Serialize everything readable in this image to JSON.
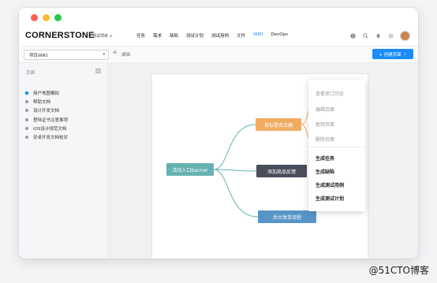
{
  "app": {
    "brand": "CORNERSTONE",
    "project_switch": "测试项目 ∨"
  },
  "nav": {
    "items": [
      {
        "label": "任务",
        "active": false
      },
      {
        "label": "需求",
        "active": false
      },
      {
        "label": "缺陷",
        "active": false
      },
      {
        "label": "测试计划",
        "active": false
      },
      {
        "label": "测试用例",
        "active": false
      },
      {
        "label": "文件",
        "active": false
      },
      {
        "label": "WIKI",
        "active": true
      },
      {
        "label": "DevOps",
        "active": false
      }
    ]
  },
  "toolbar": {
    "wiki_select": "项目WIKI",
    "add": "+",
    "edit_label": "编辑",
    "create_button": "+ 创建页面",
    "create_caret": "∨"
  },
  "sidebar": {
    "header": "页面",
    "items": [
      {
        "label": "用户地图模拟",
        "active": true
      },
      {
        "label": "帮助文档",
        "active": false
      },
      {
        "label": "设计开发文档",
        "active": false
      },
      {
        "label": "登陆证书注意事项",
        "active": false
      },
      {
        "label": "iOS设计规范文档",
        "active": false
      },
      {
        "label": "安卓开发文档校对",
        "active": false
      }
    ]
  },
  "mindmap": {
    "root": "活动入口banner",
    "children": [
      "目标是否正确",
      "添加商品反馈",
      "后台发货流程"
    ]
  },
  "context_menu": {
    "items_dim": [
      "查看修订历史",
      "编辑页面",
      "复制页面",
      "删除页面"
    ],
    "items_bold": [
      "生成任务",
      "生成缺陷",
      "生成测试用例",
      "生成测试计划"
    ]
  },
  "watermark": "@51CTO博客",
  "colors": {
    "accent": "#1a8cff",
    "root_node": "#64b3b0",
    "goal_node": "#f1ac64",
    "add_node": "#4a4e5c",
    "ship_node": "#5794c8"
  }
}
